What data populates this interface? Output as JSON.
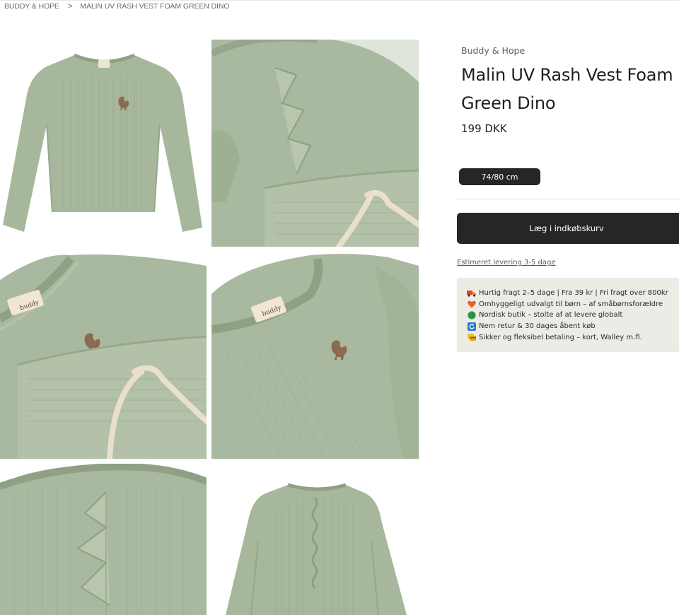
{
  "breadcrumb": {
    "items": [
      "BUDDY & HOPE",
      "MALIN UV RASH VEST FOAM GREEN DINO"
    ],
    "separator": ">"
  },
  "product": {
    "brand": "Buddy & Hope",
    "title": "Malin UV Rash Vest Foam Green Dino",
    "price": "199 DKK",
    "selected_size": "74/80 cm",
    "add_to_cart": "Læg i indkøbskurv",
    "delivery_estimate": "Estimeret levering 3-5 dage"
  },
  "usps": [
    {
      "icon": "truck-icon",
      "text": "Hurtig fragt 2–5 dage | Fra 39 kr | Fri fragt over 800kr"
    },
    {
      "icon": "heart-icon",
      "text": "Omhyggeligt udvalgt til børn – af småbørnsforældre"
    },
    {
      "icon": "globe-icon",
      "text": "Nordisk butik – stolte af at levere globalt"
    },
    {
      "icon": "return-icon",
      "text": "Nem retur & 30 dages åbent køb"
    },
    {
      "icon": "secure-payment-icon",
      "text": "Sikker og fleksibel betaling – kort, Walley m.fl."
    }
  ],
  "images": [
    {
      "label": "buddy"
    },
    {
      "label": "buddy"
    }
  ],
  "colors": {
    "garment": "#a7b79c",
    "garment_shadow": "#8fa085",
    "dark_button": "#262626",
    "usp_background": "#ecebe6",
    "drawstring": "#eadfcb"
  }
}
